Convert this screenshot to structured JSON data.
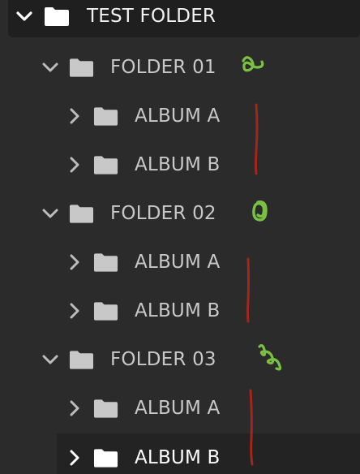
{
  "tree": {
    "root": {
      "label": "TEST FOLDER",
      "expanded": true
    },
    "folders": [
      {
        "label": "FOLDER 01",
        "expanded": true,
        "albums": [
          {
            "label": "ALBUM A",
            "expanded": false
          },
          {
            "label": "ALBUM B",
            "expanded": false
          }
        ]
      },
      {
        "label": "FOLDER 02",
        "expanded": true,
        "albums": [
          {
            "label": "ALBUM A",
            "expanded": false
          },
          {
            "label": "ALBUM B",
            "expanded": false
          }
        ]
      },
      {
        "label": "FOLDER 03",
        "expanded": true,
        "albums": [
          {
            "label": "ALBUM A",
            "expanded": false
          },
          {
            "label": "ALBUM B",
            "expanded": false,
            "selected": true
          }
        ]
      }
    ]
  },
  "colors": {
    "background": "#2b2b2b",
    "root_row": "#1f1f1f",
    "selected_row": "#232323",
    "text": "#c8c8c8",
    "annotation_green": "#7ac143",
    "annotation_red": "#a3261c"
  },
  "annotations": [
    {
      "kind": "green-scribble",
      "near": "FOLDER 01"
    },
    {
      "kind": "red-line",
      "near": "FOLDER 01 albums"
    },
    {
      "kind": "green-scribble",
      "near": "FOLDER 02"
    },
    {
      "kind": "red-line",
      "near": "FOLDER 02 albums"
    },
    {
      "kind": "green-scribble",
      "near": "FOLDER 03"
    },
    {
      "kind": "red-line",
      "near": "FOLDER 03 albums"
    }
  ]
}
